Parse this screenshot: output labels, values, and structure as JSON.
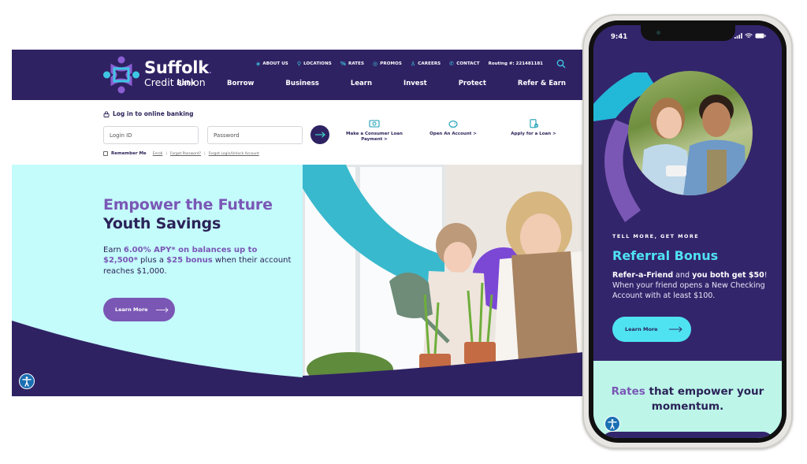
{
  "desktop": {
    "brand": {
      "name": "Suffolk",
      "dot": ".",
      "subtitle": "Credit Union"
    },
    "utility_nav": [
      {
        "icon": "diamond-icon",
        "label": "ABOUT US"
      },
      {
        "icon": "location-pin-icon",
        "label": "LOCATIONS"
      },
      {
        "icon": "percent-icon",
        "label": "RATES"
      },
      {
        "icon": "tag-icon",
        "label": "PROMOS"
      },
      {
        "icon": "person-icon",
        "label": "CAREERS"
      },
      {
        "icon": "phone-icon",
        "label": "CONTACT"
      }
    ],
    "routing": "Routing #: 221481181",
    "main_nav": [
      "Bank",
      "Borrow",
      "Business",
      "Learn",
      "Invest",
      "Protect",
      "Refer & Earn"
    ],
    "login": {
      "title": "Log in to online banking",
      "login_placeholder": "Login ID",
      "password_placeholder": "Password",
      "remember": "Remember Me",
      "links": [
        "Enroll",
        "Forgot Password?",
        "Forgot Login/Unlock Account"
      ]
    },
    "quick_links": [
      {
        "icon": "cash-icon",
        "label": "Make a Consumer Loan Payment",
        "arrow": ">"
      },
      {
        "icon": "piggy-bank-icon",
        "label": "Open An Account",
        "arrow": ">"
      },
      {
        "icon": "document-check-icon",
        "label": "Apply for a Loan",
        "arrow": ">"
      }
    ],
    "hero": {
      "line1": "Empower the Future",
      "line2": "Youth Savings",
      "body_pre": "Earn ",
      "body_b1": "6.00% APY* on balances up to $2,500*",
      "body_mid": " plus a ",
      "body_b2": "$25 bonus",
      "body_post": " when their account reaches $1,000.",
      "cta": "Learn More"
    }
  },
  "phone": {
    "time": "9:41",
    "kicker": "TELL MORE, GET MORE",
    "title": "Referral Bonus",
    "body_b1": "Refer-a-Friend",
    "body_mid": " and ",
    "body_b2": "you both get $50",
    "body_post": "! When your friend opens a New Checking Account with at least $100.",
    "cta": "Learn More",
    "rates_accent": "Rates",
    "rates_rest": " that empower your momentum."
  },
  "colors": {
    "navy": "#2f2263",
    "purple": "#7a57b5",
    "aqua": "#c4fbfb",
    "cyan": "#4fe3f2",
    "mint": "#bdf6e9",
    "accessibility_blue": "#1b6fb3"
  }
}
